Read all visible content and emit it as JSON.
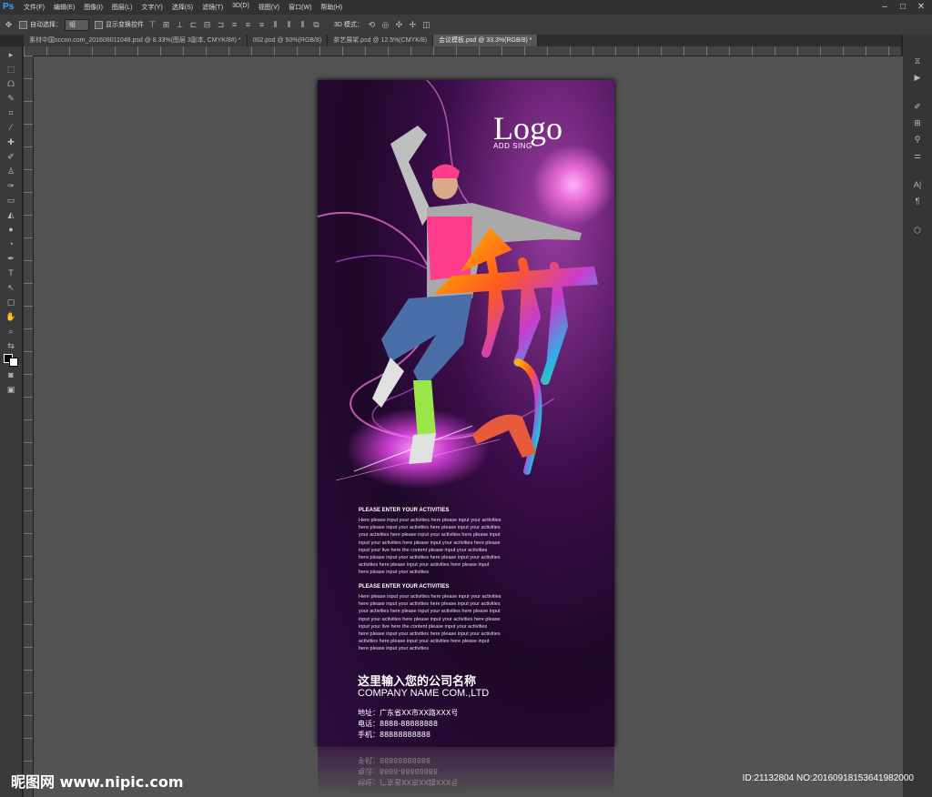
{
  "app": {
    "logo": "Ps"
  },
  "menu": [
    "文件(F)",
    "编辑(E)",
    "图像(I)",
    "图层(L)",
    "文字(Y)",
    "选择(S)",
    "滤镜(T)",
    "3D(D)",
    "视图(V)",
    "窗口(W)",
    "帮助(H)"
  ],
  "options": {
    "auto_select_label": "自动选择：",
    "auto_select_value": "组",
    "show_transform_label": "显示变换控件",
    "mode_3d_label": "3D 模式："
  },
  "tabs": [
    {
      "label": "素材中国sccnn.com_201608011048.psd @ 8.33%(图层 3副本, CMYK/8#) *",
      "active": false
    },
    {
      "label": "002.psd @ 50%(RGB/8)",
      "active": false
    },
    {
      "label": "茶艺展架.psd @ 12.5%(CMYK/8)",
      "active": false
    },
    {
      "label": "会议模板.psd @ 33.3%(RGB/8) *",
      "active": true
    }
  ],
  "poster": {
    "logo": "Logo",
    "logo_sub": "ADD SING",
    "activity_title": "PLEASE ENTER YOUR ACTIVITIES",
    "activity_lines": [
      "Here please input your activities here please input your activities",
      "here please input your activities here please input your activities",
      "your activities here please input your activities here please input",
      "input your activities here please input your activities here please",
      "input your live here the content please input your activities",
      "here please input your activities here please input your activities",
      "activities here please input your activities here please input",
      "here please input your activities"
    ],
    "company_cn": "这里输入您的公司名称",
    "company_en": "COMPANY NAME COM.,LTD",
    "address": "地址：广东省XX市XX路XXX号",
    "phone": "电话：8888-88888888",
    "mobile": "手机：88888888888"
  },
  "watermark": {
    "site": "昵图网 www.nipic.com",
    "id": "ID:21132804 NO:20160918153641982000"
  },
  "colors": {
    "accent": "#31a8ff"
  }
}
